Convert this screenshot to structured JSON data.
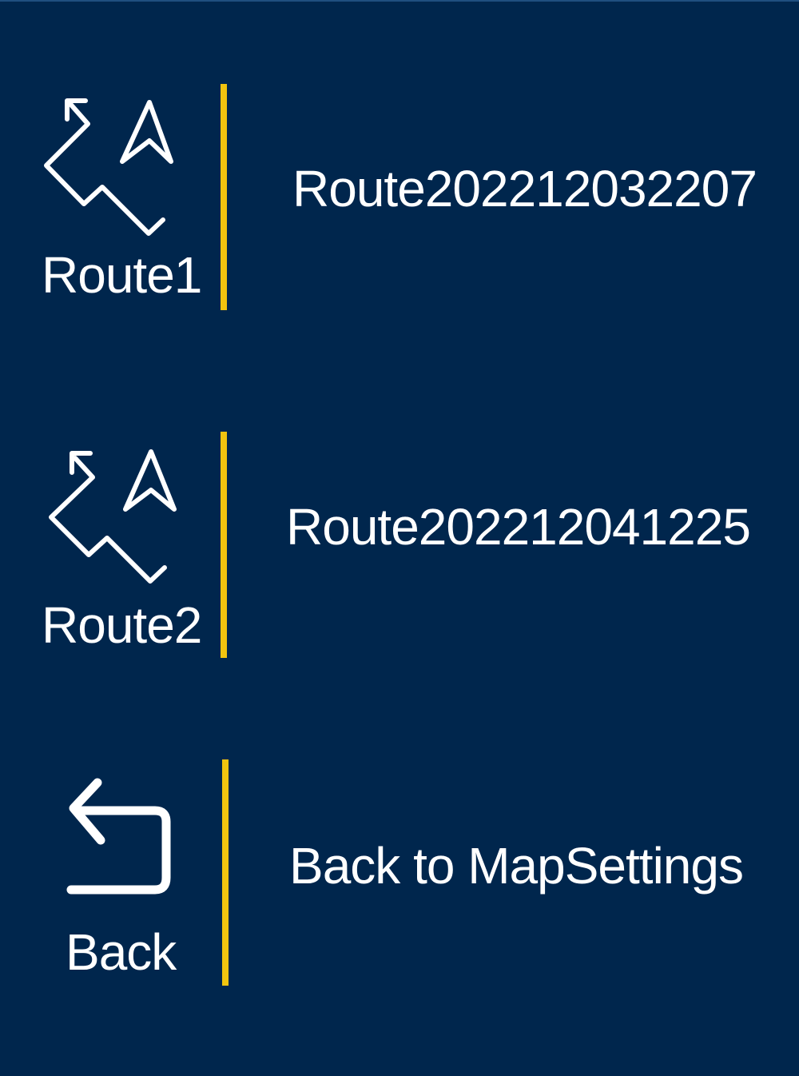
{
  "menu": {
    "items": [
      {
        "icon": "route-navigation-icon",
        "short_label": "Route1",
        "label": "Route202212032207"
      },
      {
        "icon": "route-navigation-icon",
        "short_label": "Route2",
        "label": "Route202212041225"
      },
      {
        "icon": "back-arrow-icon",
        "short_label": "Back",
        "label": "Back to MapSettings"
      }
    ]
  },
  "colors": {
    "background": "#00264d",
    "text": "#ffffff",
    "accent": "#f2c40f"
  }
}
